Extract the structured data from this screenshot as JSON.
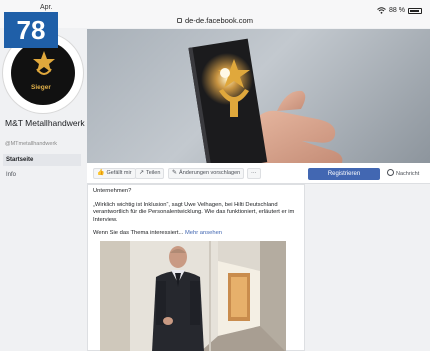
{
  "badge": {
    "number": "78"
  },
  "statusbar": {
    "time": "Apr.",
    "url": "de-de.facebook.com",
    "battery": "88 %"
  },
  "page": {
    "name": "M&T Metallhandwerk",
    "handle": "@MTmetallhandwerk",
    "profile_label": "Sieger"
  },
  "nav": {
    "items": [
      {
        "label": "Startseite"
      },
      {
        "label": "Info"
      }
    ]
  },
  "actions": {
    "like": "Gefällt mir",
    "share": "Teilen",
    "suggest": "Änderungen vorschlagen",
    "more": "···",
    "register": "Registrieren",
    "message": "Nachricht"
  },
  "post": {
    "line1": "Unternehmen?",
    "line2": "„Wirklich wichtig ist Inklusion“, sagt Uwe Velhagen, bei Hilti Deutschland verantwortlich für die Personalentwicklung. Wie das funktioniert, erläutert er im Interview.",
    "line3": "Wenn Sie das Thema interessiert...",
    "more_link": "Mehr ansehen"
  },
  "colors": {
    "facebook_blue": "#4267b2",
    "badge_blue": "#1f5fa8",
    "trophy_gold": "#e0a83c"
  }
}
